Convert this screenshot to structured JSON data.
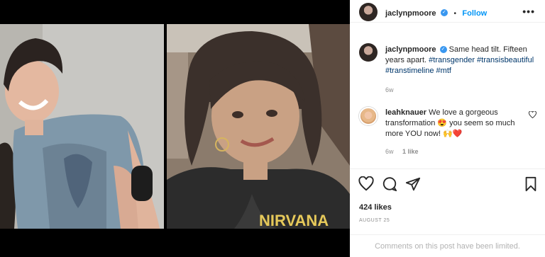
{
  "post": {
    "owner": {
      "username": "jaclynpmoore",
      "verified_badge": "✓",
      "follow_label": "Follow",
      "more_label": "•••"
    },
    "caption": {
      "username": "jaclynpmoore",
      "text": "Same head tilt. Fifteen years apart.",
      "hashtags": [
        "#transgender",
        "#transisbeautiful",
        "#transtimeline",
        "#mtf"
      ],
      "time": "6w"
    },
    "comments": [
      {
        "username": "leahknauer",
        "text": "We love a gorgeous transformation 😍 you seem so much more YOU now! 🙌❤️",
        "time": "6w",
        "likes": "1 like"
      }
    ],
    "likes": "424 likes",
    "date": "AUGUST 25",
    "comments_limited": "Comments on this post have been limited."
  },
  "icons": {
    "like": "heart-icon",
    "comment": "comment-icon",
    "share": "share-icon",
    "save": "bookmark-icon",
    "more": "more-options-icon"
  },
  "colors": {
    "link_blue": "#0095f6",
    "hashtag": "#00376b",
    "muted": "#8e8e8e"
  }
}
